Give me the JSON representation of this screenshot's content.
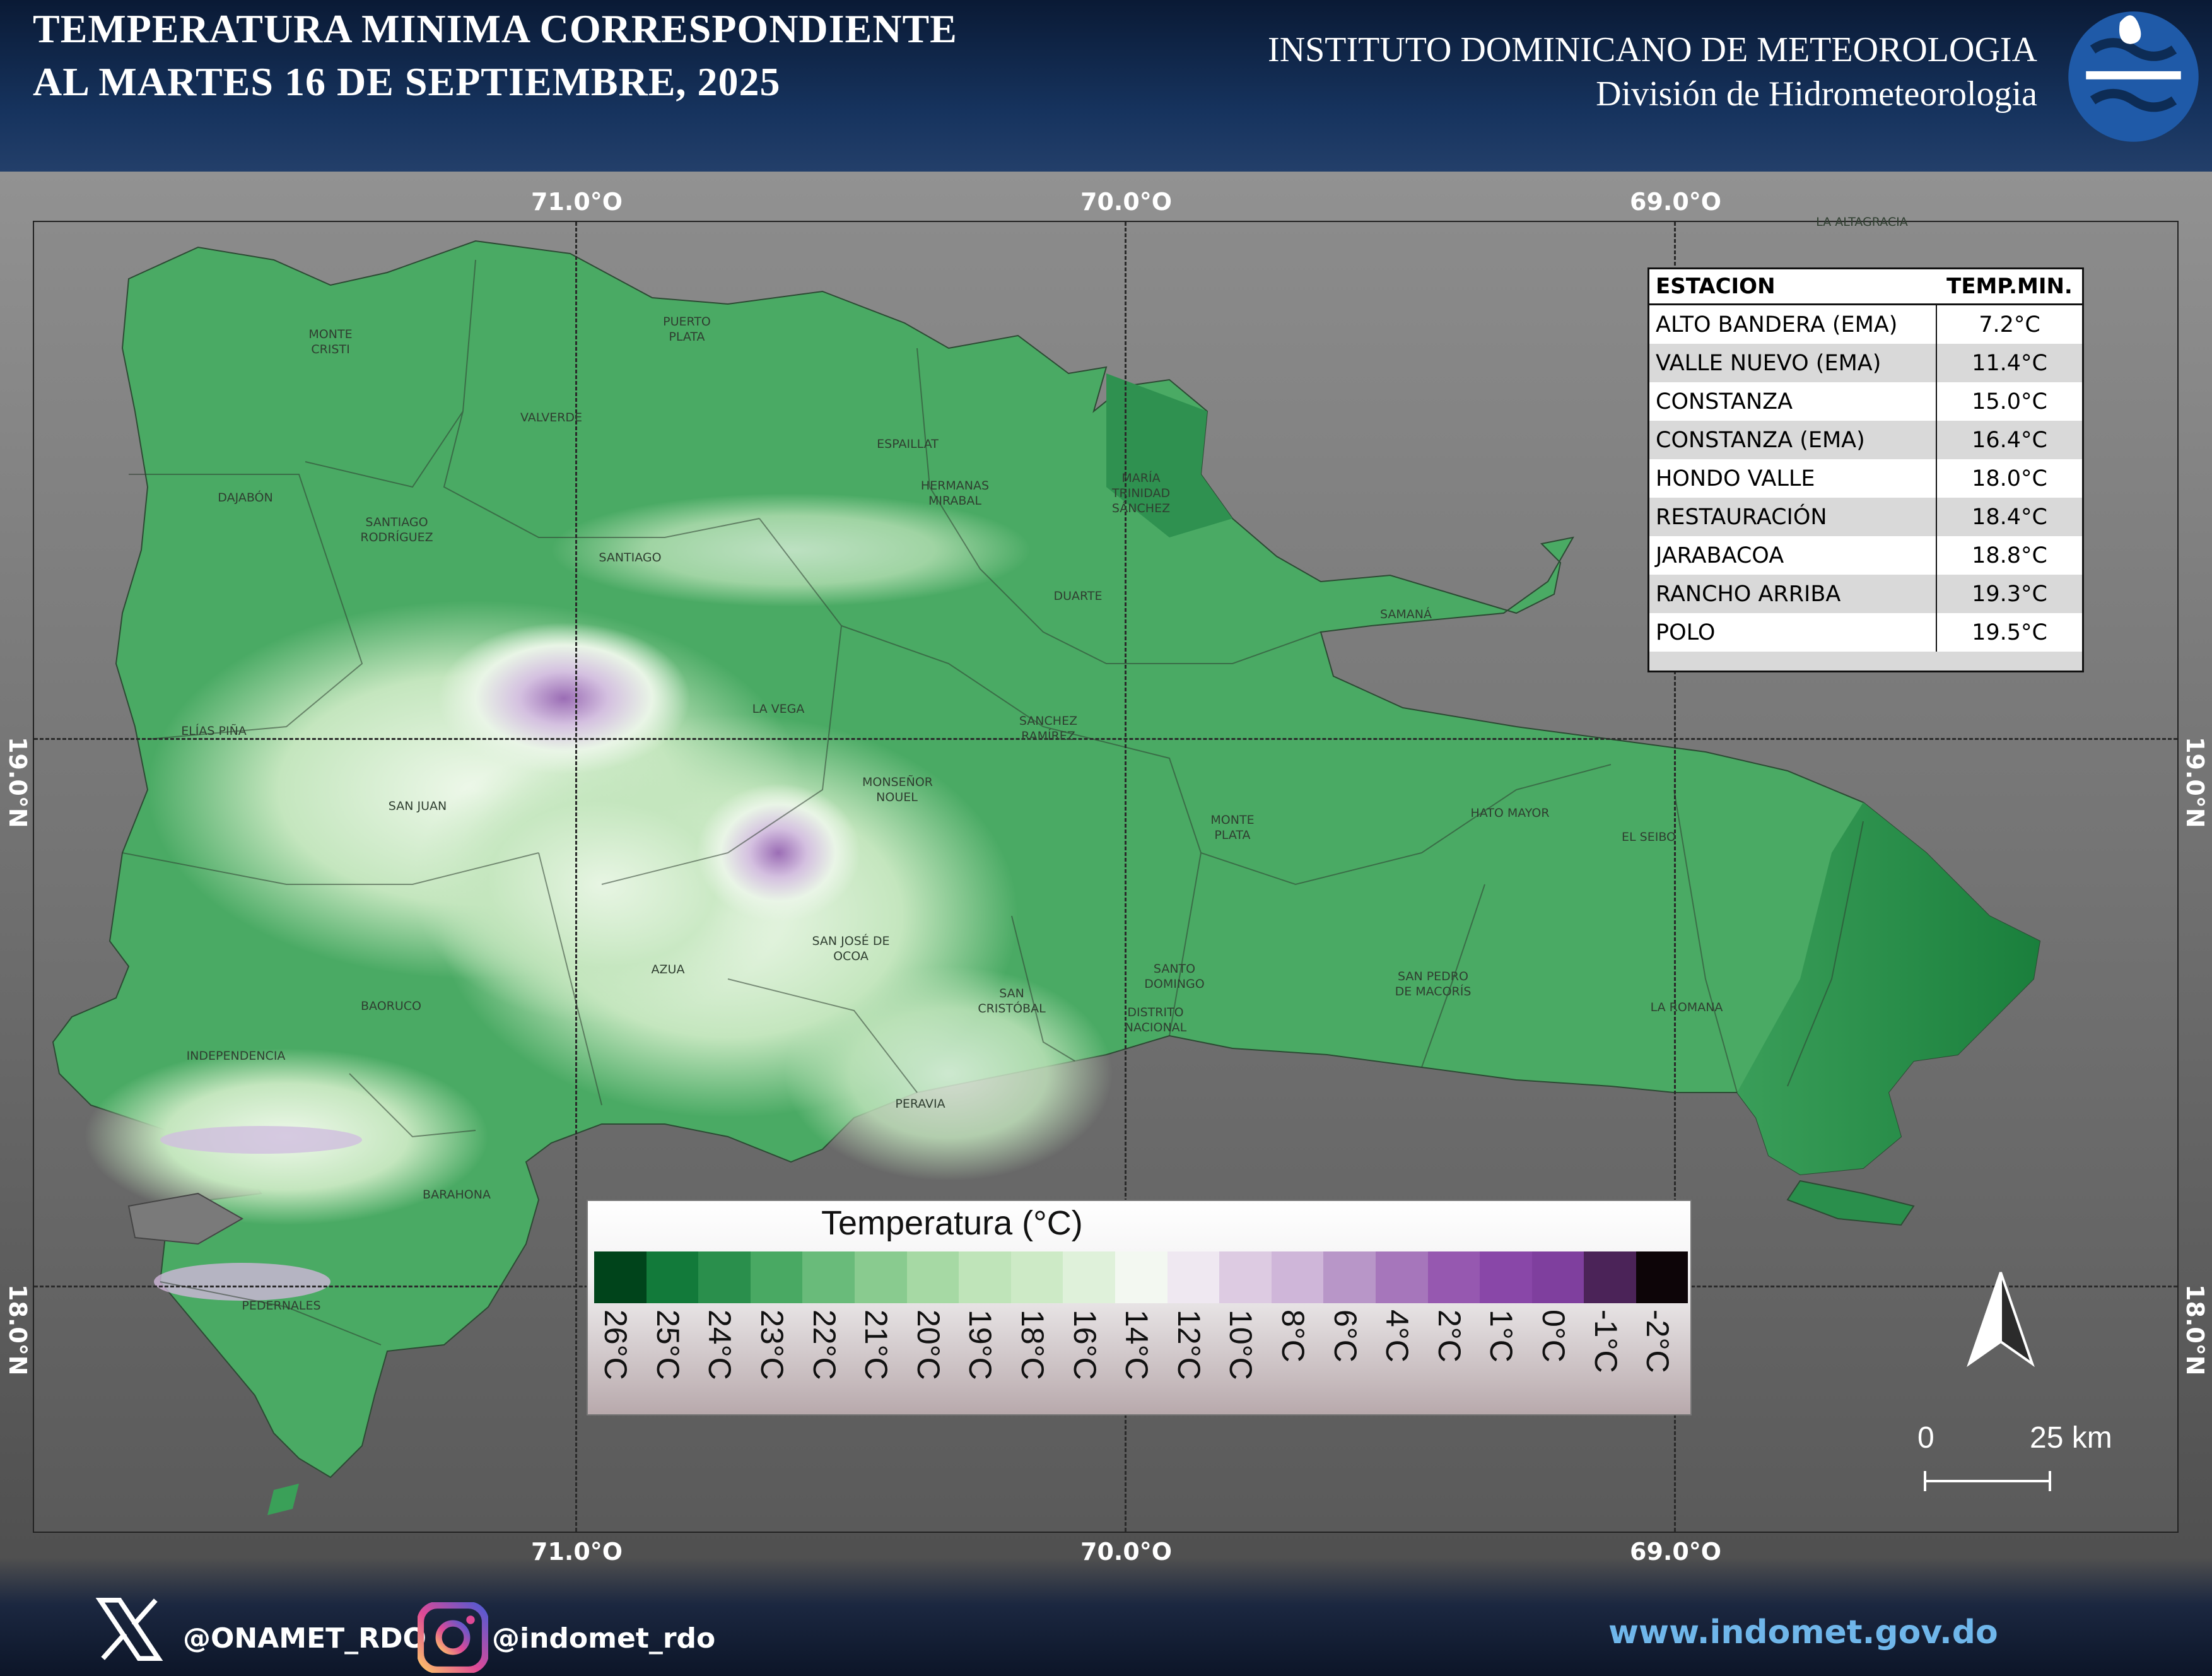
{
  "header": {
    "title_line1": "TEMPERATURA MINIMA CORRESPONDIENTE",
    "title_line2": "AL MARTES 16 DE SEPTIEMBRE, 2025",
    "institute": "INSTITUTO DOMINICANO DE METEOROLOGIA",
    "division": "División de Hidrometeorologia"
  },
  "grid": {
    "lon_labels": [
      "71.0°O",
      "70.0°O",
      "69.0°O"
    ],
    "lat_labels": [
      "19.0°N",
      "18.0°N"
    ]
  },
  "provinces": [
    "MONTE CRISTI",
    "PUERTO PLATA",
    "VALVERDE",
    "DAJABÓN",
    "SANTIAGO RODRÍGUEZ",
    "SANTIAGO",
    "ESPAILLAT",
    "HERMANAS MIRABAL",
    "MARÍA TRINIDAD SÁNCHEZ",
    "DUARTE",
    "SAMANÁ",
    "ELÍAS PIÑA",
    "LA VEGA",
    "SANCHEZ RAMÍREZ",
    "SAN JUAN",
    "MONSEÑOR NOUEL",
    "MONTE PLATA",
    "HATO MAYOR",
    "EL SEIBO",
    "SAN JOSÉ DE OCOA",
    "AZUA",
    "SANTO DOMINGO",
    "SAN PEDRO DE MACORÍS",
    "LA ALTAGRACIA",
    "BAORUCO",
    "SAN CRISTÓBAL",
    "DISTRITO NACIONAL",
    "LA ROMANA",
    "INDEPENDENCIA",
    "PERAVIA",
    "BARAHONA",
    "PEDERNALES"
  ],
  "stations_table": {
    "header": [
      "ESTACION",
      "TEMP.MIN."
    ],
    "rows": [
      [
        "ALTO BANDERA (EMA)",
        "7.2°C"
      ],
      [
        "VALLE NUEVO (EMA)",
        "11.4°C"
      ],
      [
        "CONSTANZA",
        "15.0°C"
      ],
      [
        "CONSTANZA (EMA)",
        "16.4°C"
      ],
      [
        "HONDO VALLE",
        "18.0°C"
      ],
      [
        "RESTAURACIÓN",
        "18.4°C"
      ],
      [
        "JARABACOA",
        "18.8°C"
      ],
      [
        "RANCHO ARRIBA",
        "19.3°C"
      ],
      [
        "POLO",
        "19.5°C"
      ]
    ]
  },
  "legend": {
    "title": "Temperatura (°C)",
    "labels": [
      "26°C",
      "25°C",
      "24°C",
      "23°C",
      "22°C",
      "21°C",
      "20°C",
      "19°C",
      "18°C",
      "16°C",
      "14°C",
      "12°C",
      "10°C",
      "8°C",
      "6°C",
      "4°C",
      "2°C",
      "1°C",
      "0°C",
      "-1°C",
      "-2°C"
    ],
    "colors": [
      "#00441b",
      "#127a3a",
      "#2a8f4c",
      "#49a963",
      "#69bb7a",
      "#89cb8f",
      "#a6d9a4",
      "#bfe4b9",
      "#cdeac6",
      "#dff1da",
      "#f3f8f1",
      "#efe8f1",
      "#ddcbe2",
      "#cfb6d9",
      "#b896c8",
      "#a676bb",
      "#9658b0",
      "#8947a8",
      "#7f3f9e",
      "#4b2358",
      "#0d0508"
    ]
  },
  "scale": {
    "start": "0",
    "end": "25 km"
  },
  "footer": {
    "twitter": "@ONAMET_RDO",
    "instagram": "@indomet_rdo",
    "website": "www.indomet.gov.do"
  }
}
